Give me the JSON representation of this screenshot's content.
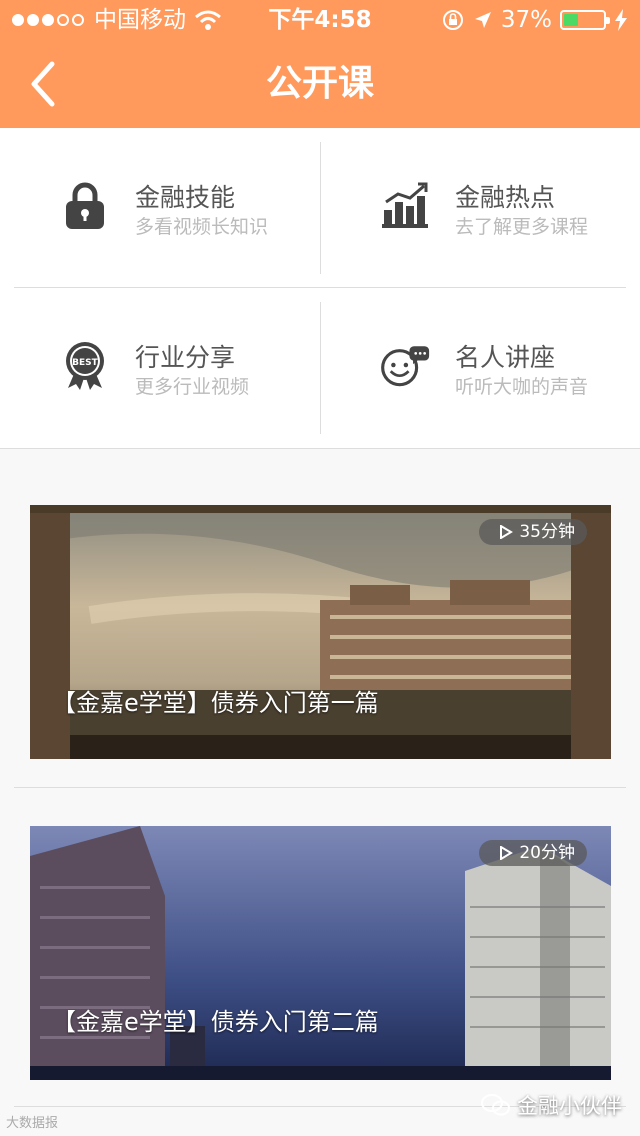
{
  "status_bar": {
    "carrier": "中国移动",
    "time": "下午4:58",
    "battery_percent": "37%",
    "battery_level": 0.37
  },
  "header": {
    "title": "公开课",
    "bg_color": "#ff9a5c"
  },
  "categories": [
    {
      "title": "金融技能",
      "subtitle": "多看视频长知识",
      "icon": "lock-icon"
    },
    {
      "title": "金融热点",
      "subtitle": "去了解更多课程",
      "icon": "bar-chart-icon"
    },
    {
      "title": "行业分享",
      "subtitle": "更多行业视频",
      "icon": "best-badge-icon",
      "badge_text": "BEST"
    },
    {
      "title": "名人讲座",
      "subtitle": "听听大咖的声音",
      "icon": "smiley-chat-icon"
    }
  ],
  "courses": [
    {
      "title": "【金嘉e学堂】债券入门第一篇",
      "duration": "35分钟",
      "scene": "buildings-sunset"
    },
    {
      "title": "【金嘉e学堂】债券入门第二篇",
      "duration": "20分钟",
      "scene": "skyscrapers-night"
    }
  ],
  "watermark": {
    "left": "大数据报",
    "right": "金融小伙伴"
  }
}
